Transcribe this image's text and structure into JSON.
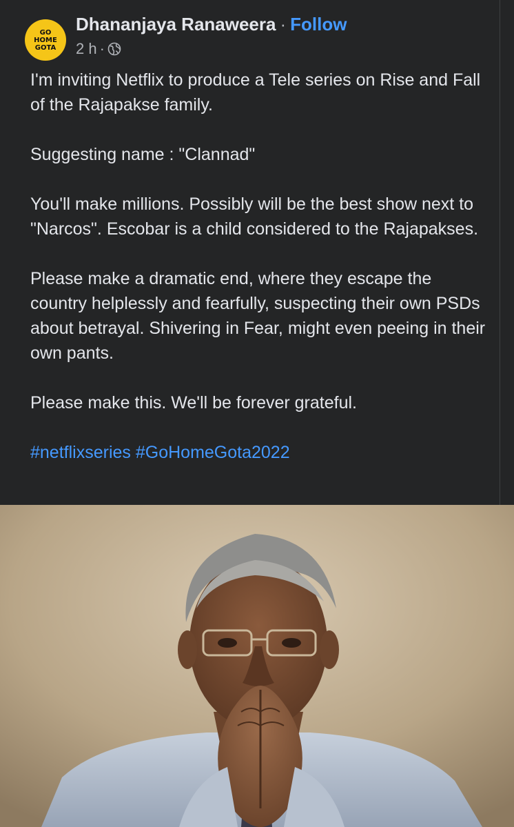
{
  "post": {
    "author": {
      "name": "Dhananjaya Ranaweera",
      "avatar_lines": [
        "GO",
        "HOME",
        "GOTA"
      ]
    },
    "separator": "·",
    "follow_label": "Follow",
    "timestamp": "2 h",
    "meta_separator": "·",
    "privacy_icon": "globe-icon",
    "paragraphs": [
      "I'm inviting Netflix to produce a Tele series on Rise and Fall of the Rajapakse family.",
      "Suggesting name : \"Clannad\"",
      "You'll make millions. Possibly will be the best show next to \"Narcos\". Escobar is a child considered to the Rajapakses.",
      "Please make a dramatic end, where they escape the country helplessly and fearfully, suspecting their own PSDs about betrayal. Shivering in Fear, might even peeing in their own pants.",
      "Please make this. We'll be forever grateful."
    ],
    "hashtags": [
      "#netflixseries",
      "#GoHomeGota2022"
    ],
    "image": {
      "subject": "man-with-clasped-hands-photo"
    }
  },
  "colors": {
    "background": "#242526",
    "text": "#e4e6eb",
    "secondary_text": "#b0b3b8",
    "link": "#4599ff",
    "avatar_bg": "#f5c518"
  }
}
